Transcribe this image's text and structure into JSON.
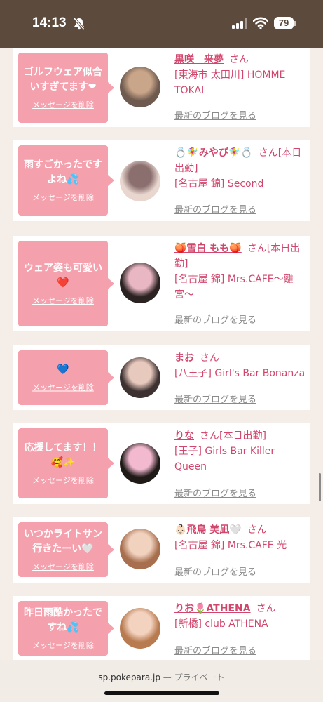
{
  "status_bar": {
    "time": "14:13",
    "battery": "79"
  },
  "cards": [
    {
      "message": "ゴルフウェア似合いすぎてます❤",
      "delete_label": "メッセージを削除",
      "name": "黒咲　来夢",
      "honorific": "さん",
      "status": "",
      "shop": "[東海市 太田川] HOMME TOKAI",
      "blog_label": "最新のブログを見る",
      "avatar_colors": [
        "#6e5a4e",
        "#c9a58a"
      ]
    },
    {
      "message": "雨すごかったですよね💦",
      "delete_label": "メッセージを削除",
      "name": "💍🧚‍♀️みやび🧚‍♀️💍",
      "honorific": "さん",
      "status": "[本日出勤]",
      "shop": "[名古屋 錦] Second",
      "blog_label": "最新のブログを見る",
      "avatar_colors": [
        "#e8d6cf",
        "#8b6f6f"
      ]
    },
    {
      "message": "ウェア姿も可愛い❤️",
      "delete_label": "メッセージを削除",
      "name": "🍑雪白 もも🍑",
      "honorific": "さん",
      "status": "[本日出勤]",
      "shop": "[名古屋 錦] Mrs.CAFE〜離宮〜",
      "blog_label": "最新のブログを見る",
      "avatar_colors": [
        "#2b2322",
        "#e9b7c4"
      ]
    },
    {
      "message": "💙",
      "delete_label": "メッセージを削除",
      "name": "まお",
      "honorific": "さん",
      "status": "",
      "shop": "[八王子] Girl's Bar Bonanza",
      "blog_label": "最新のブログを見る",
      "avatar_colors": [
        "#3d3131",
        "#e7c9bd"
      ]
    },
    {
      "message": "応援してます！！🥰✨",
      "delete_label": "メッセージを削除",
      "name": "りな",
      "honorific": "さん",
      "status": "[本日出勤]",
      "shop": "[王子] Girls Bar Killer Queen",
      "blog_label": "最新のブログを見る",
      "avatar_colors": [
        "#1f1a18",
        "#f2b9cf"
      ]
    },
    {
      "message": "いつかライトサン行きたーい🤍",
      "delete_label": "メッセージを削除",
      "name": "👶🏻飛鳥 美凪🤍",
      "honorific": "さん",
      "status": "",
      "shop": "[名古屋 錦] Mrs.CAFE 光",
      "blog_label": "最新のブログを見る",
      "avatar_colors": [
        "#a86f4e",
        "#f0d2bf"
      ]
    },
    {
      "message": "昨日雨酷かったですね💦",
      "delete_label": "メッセージを削除",
      "name": "りお🌷ATHENA",
      "honorific": "さん",
      "status": "",
      "shop": "[新橋] club ATHENA",
      "blog_label": "最新のブログを見る",
      "avatar_colors": [
        "#b87a4f",
        "#f3d3c0"
      ]
    }
  ],
  "browser": {
    "domain": "sp.pokepara.jp",
    "separator": "—",
    "mode": "プライベート"
  }
}
